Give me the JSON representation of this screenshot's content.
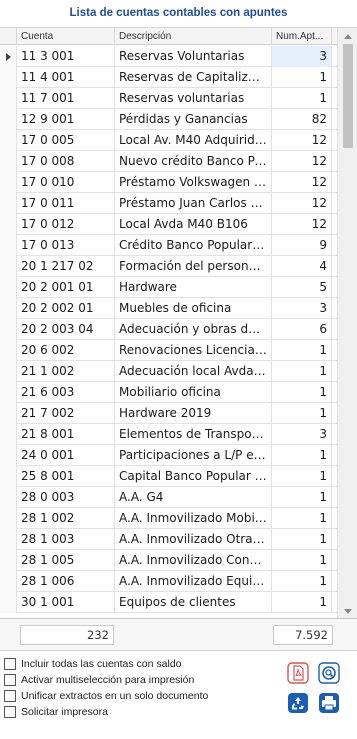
{
  "panel": {
    "title": "Lista de cuentas contables con apuntes"
  },
  "columns": {
    "cuenta": "Cuenta",
    "descripcion": "Descripción",
    "num": "Num.Apt..."
  },
  "rows": [
    {
      "cuenta": "11 3 001",
      "descripcion": "Reservas Voluntarias",
      "num": "3",
      "selected": true
    },
    {
      "cuenta": "11 4 001",
      "descripcion": "Reservas de Capitalizaci...",
      "num": "1"
    },
    {
      "cuenta": "11 7 001",
      "descripcion": "Reservas voluntarias",
      "num": "1"
    },
    {
      "cuenta": "12 9 001",
      "descripcion": "Pérdidas y Ganancias",
      "num": "82"
    },
    {
      "cuenta": "17 0 005",
      "descripcion": "Local Av. M40 Adquirido...",
      "num": "12"
    },
    {
      "cuenta": "17 0 008",
      "descripcion": "Nuevo crédito Banco Po...",
      "num": "12"
    },
    {
      "cuenta": "17 0 010",
      "descripcion": "Préstamo Volkswagen F...",
      "num": "12"
    },
    {
      "cuenta": "17 0 011",
      "descripcion": "Préstamo Juan Carlos L...",
      "num": "12"
    },
    {
      "cuenta": "17 0 012",
      "descripcion": "Local Avda M40 B106",
      "num": "12"
    },
    {
      "cuenta": "17 0 013",
      "descripcion": "Crédito Banco Popular 4...",
      "num": "9"
    },
    {
      "cuenta": "20 1 217 02",
      "descripcion": "Formación del personal ...",
      "num": "4"
    },
    {
      "cuenta": "20 2 001 01",
      "descripcion": "Hardware",
      "num": "5"
    },
    {
      "cuenta": "20 2 002 01",
      "descripcion": "Muebles de oficina",
      "num": "3"
    },
    {
      "cuenta": "20 2 003 04",
      "descripcion": "Adecuación y obras del l...",
      "num": "6"
    },
    {
      "cuenta": "20 6 002",
      "descripcion": "Renovaciones Licencias ...",
      "num": "1"
    },
    {
      "cuenta": "21 1 002",
      "descripcion": "Adecuación local Avda ...",
      "num": "1"
    },
    {
      "cuenta": "21 6 003",
      "descripcion": "Mobiliario oficina",
      "num": "1"
    },
    {
      "cuenta": "21 7 002",
      "descripcion": "Hardware 2019",
      "num": "1"
    },
    {
      "cuenta": "21 8 001",
      "descripcion": "Elementos de Transporte",
      "num": "3"
    },
    {
      "cuenta": "24 0 001",
      "descripcion": "Participaciones a L/P en...",
      "num": "1"
    },
    {
      "cuenta": "25 8 001",
      "descripcion": "Capital Banco Popular D...",
      "num": "1"
    },
    {
      "cuenta": "28 0 003",
      "descripcion": "A.A. G4",
      "num": "1"
    },
    {
      "cuenta": "28 1 002",
      "descripcion": "A.A. Inmovilizado Mobili...",
      "num": "1"
    },
    {
      "cuenta": "28 1 003",
      "descripcion": "A.A. Inmovilizado Otras ...",
      "num": "1"
    },
    {
      "cuenta": "28 1 005",
      "descripcion": "A.A. Inmovilizado Const...",
      "num": "1"
    },
    {
      "cuenta": "28 1 006",
      "descripcion": "A.A. Inmovilizado Equip...",
      "num": "1"
    },
    {
      "cuenta": "30 1 001",
      "descripcion": "Equipos de clientes",
      "num": "1"
    }
  ],
  "footer": {
    "count": "232",
    "total": "7.592"
  },
  "options": [
    {
      "label": "Incluir todas las cuentas con saldo",
      "checked": false
    },
    {
      "label": "Activar multiselección para impresión",
      "checked": false
    },
    {
      "label": "Unificar extractos en un solo documento",
      "checked": false
    },
    {
      "label": "Solicitar impresora",
      "checked": false
    }
  ],
  "icons": {
    "pdf": "pdf-icon",
    "search": "search-icon",
    "recycle": "recycle-icon",
    "print": "printer-icon"
  },
  "colors": {
    "title": "#1f4e9e",
    "pdf": "#d9534f",
    "accent": "#1a5fb4",
    "selected_cell": "#e4effb"
  }
}
